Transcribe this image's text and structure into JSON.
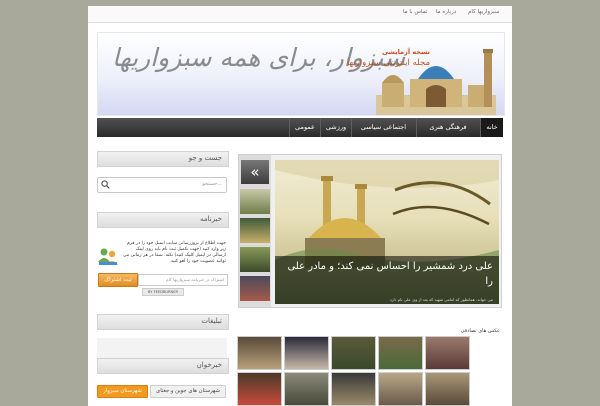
{
  "topnav": {
    "items": [
      "سبزواریها کام",
      "درباره ما",
      "تماس با ما"
    ]
  },
  "header": {
    "slogan": "سبزوار، برای همه سبزواریها",
    "mag_small": "نسخه آزمایشی",
    "mag_title": "مجله اینترنتی سبزواریها"
  },
  "mainnav": {
    "items": [
      "خانه",
      "فرهنگی هنری",
      "اجتماعی سیاسی",
      "ورزشی",
      "عمومی"
    ]
  },
  "sidebar": {
    "search_title": "جست و جو",
    "search_placeholder": "جستجو...",
    "newsletter_title": "خبرنامه",
    "newsletter_text": "جهت اطلاع از بروزرسانی سایت ایمیل خود را در فرم زیر وارد کنید (جهت تکمیل ثبت نام باید روی لینک ارسالی در ایمیل کلیک کنید) نکته: شما در هر زمانی می توانید عضویت خود را لغو کنید.",
    "email_placeholder": "اشتراک در خبرنامه سبزواریها کام",
    "subscribe_button": "ثبت اشتراک",
    "feedburner": "BY FEEDBURNER",
    "ads_title": "تبلیغات",
    "news_title": "خبرخوان",
    "tags": [
      "شهرستان های جوین و جغتای",
      "شهرستان سبزوار"
    ]
  },
  "slider": {
    "arrow": "«",
    "caption": "علی درد شمشیر را احساس نمی کند؛ و مادر علی را",
    "caption_sub": "می خواند، همانطور که امامی شهید که بعد از وی علی نام دارد"
  },
  "gallery": {
    "title": "عکس های تصادفی"
  },
  "colors": {
    "page_bg": "#a8a99a",
    "nav_bg": "#2a2a2a",
    "accent_orange": "#f29a1f",
    "header_red": "#d2461e"
  }
}
